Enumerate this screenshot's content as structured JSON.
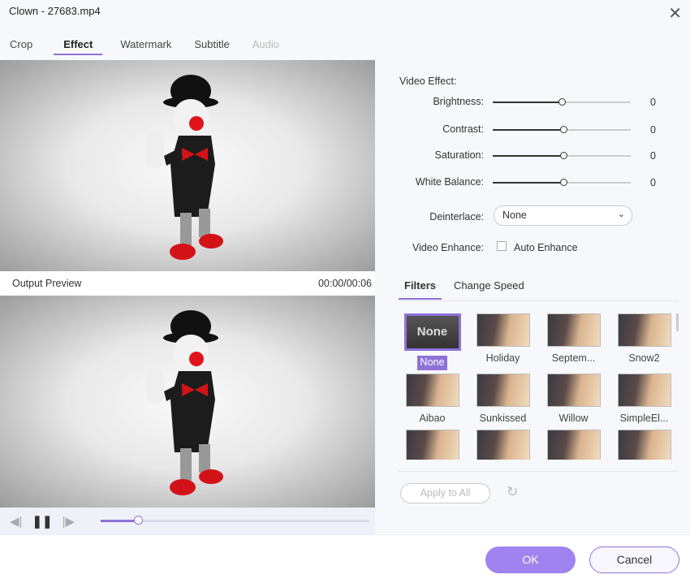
{
  "window": {
    "title": "Clown - 27683.mp4"
  },
  "tabs": [
    {
      "label": "Crop"
    },
    {
      "label": "Effect"
    },
    {
      "label": "Watermark"
    },
    {
      "label": "Subtitle"
    },
    {
      "label": "Audio"
    }
  ],
  "preview": {
    "output_label": "Output Preview",
    "time": "00:00/00:06",
    "progress_percent": 14
  },
  "video_effect": {
    "heading": "Video Effect:",
    "sliders": [
      {
        "label": "Brightness:",
        "value": "0",
        "level_percent": 50
      },
      {
        "label": "Contrast:",
        "value": "0",
        "level_percent": 51
      },
      {
        "label": "Saturation:",
        "value": "0",
        "level_percent": 51
      },
      {
        "label": "White Balance:",
        "value": "0",
        "level_percent": 51
      }
    ],
    "deinterlace": {
      "label": "Deinterlace:",
      "value": "None"
    },
    "enhance": {
      "label": "Video Enhance:",
      "checkbox_label": "Auto Enhance",
      "checked": false
    }
  },
  "filter_tabs": [
    {
      "label": "Filters"
    },
    {
      "label": "Change Speed"
    }
  ],
  "filters": [
    {
      "name": "None",
      "thumb_text": "None",
      "selected": true
    },
    {
      "name": "Holiday"
    },
    {
      "name": "Septem..."
    },
    {
      "name": "Snow2"
    },
    {
      "name": "Aibao"
    },
    {
      "name": "Sunkissed"
    },
    {
      "name": "Willow"
    },
    {
      "name": "SimpleEl..."
    },
    {
      "name": ""
    },
    {
      "name": ""
    },
    {
      "name": ""
    },
    {
      "name": ""
    }
  ],
  "actions": {
    "apply_all": "Apply to All",
    "ok": "OK",
    "cancel": "Cancel"
  },
  "colors": {
    "accent": "#8e72d8",
    "ok_button": "#a083ee"
  }
}
